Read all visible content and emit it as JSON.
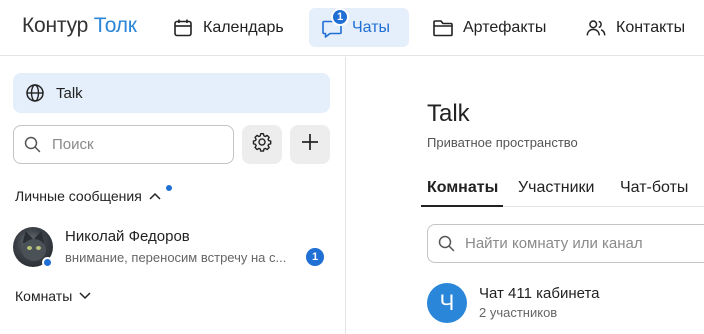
{
  "brand": {
    "part1": "Контур",
    "part2": "Толк"
  },
  "nav": {
    "calendar": "Календарь",
    "chats": "Чаты",
    "chats_badge": "1",
    "artifacts": "Артефакты",
    "contacts": "Контакты"
  },
  "sidebar": {
    "space_name": "Talk",
    "search_placeholder": "Поиск",
    "personal_header": "Личные сообщения",
    "rooms_header": "Комнаты",
    "chat": {
      "name": "Николай Федоров",
      "preview": "внимание, переносим встречу на с...",
      "unread": "1"
    }
  },
  "main": {
    "title": "Talk",
    "subtitle": "Приватное пространство",
    "tabs": [
      {
        "label": "Комнаты",
        "active": true
      },
      {
        "label": "Участники",
        "active": false
      },
      {
        "label": "Чат-боты",
        "active": false
      }
    ],
    "room_search_placeholder": "Найти комнату или канал",
    "room": {
      "avatar_letter": "Ч",
      "name": "Чат 411 кабинета",
      "members": "2 участников"
    }
  },
  "colors": {
    "accent": "#1f6fd4",
    "brand_blue": "#2a86d9",
    "active_bg": "#e5eefb"
  }
}
